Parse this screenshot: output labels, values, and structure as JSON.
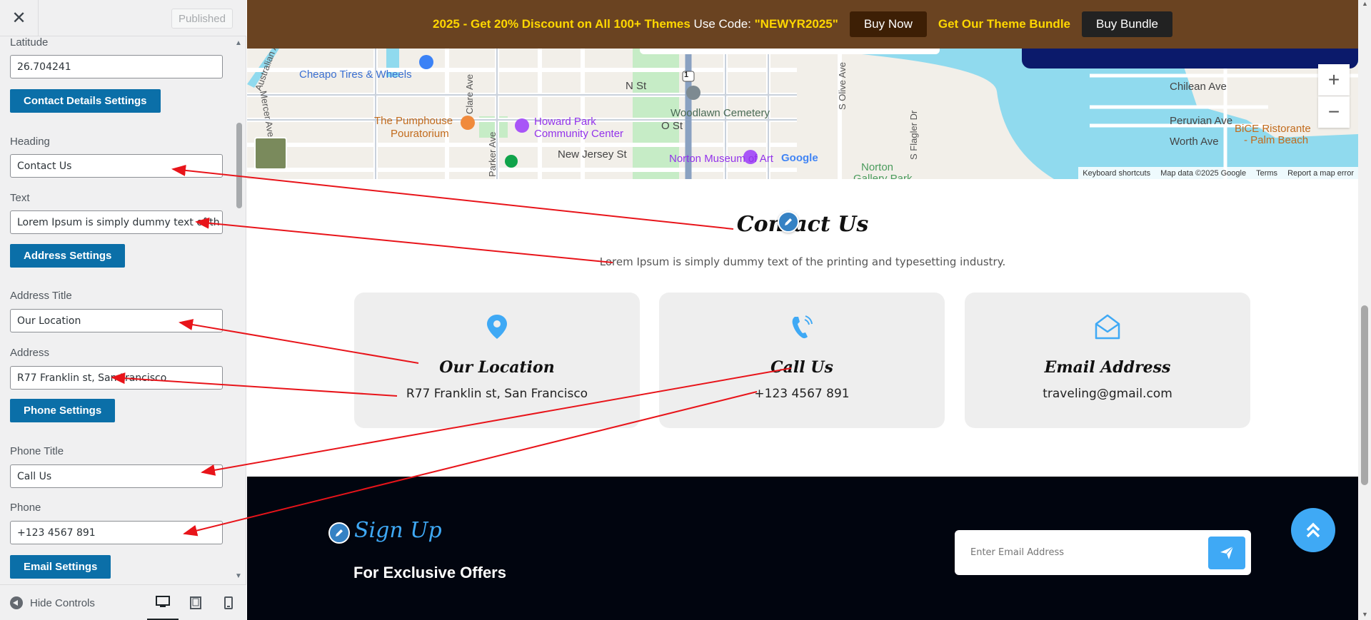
{
  "sidebar": {
    "close_label": "✕",
    "published_label": "Published",
    "latitude": {
      "label": "Latitude",
      "value": "26.704241"
    },
    "contact_details_btn": "Contact Details Settings",
    "heading": {
      "label": "Heading",
      "value": "Contact Us"
    },
    "text": {
      "label": "Text",
      "value": "Lorem Ipsum is simply dummy text of th"
    },
    "address_settings_btn": "Address Settings",
    "address_title": {
      "label": "Address Title",
      "value": "Our Location"
    },
    "address": {
      "label": "Address",
      "value": "R77 Franklin st, San Francisco"
    },
    "phone_settings_btn": "Phone Settings",
    "phone_title": {
      "label": "Phone Title",
      "value": "Call Us"
    },
    "phone": {
      "label": "Phone",
      "value": "+123 4567 891"
    },
    "email_settings_btn": "Email Settings",
    "hide_controls": "Hide Controls"
  },
  "promo": {
    "text_highlight": "2025 - Get 20% Discount on All 100+ Themes",
    "text_plain": "Use Code:",
    "code": "\"NEWYR2025\"",
    "buy_now": "Buy Now",
    "bundle_text": "Get Our Theme Bundle",
    "buy_bundle": "Buy Bundle"
  },
  "map": {
    "labels": {
      "cheapo": "Cheapo Tires & Wheels",
      "pumphouse_1": "The Pumphouse",
      "pumphouse_2": "Pouratorium",
      "howard_1": "Howard Park",
      "howard_2": "Community Center",
      "woodlawn": "Woodlawn Cemetery",
      "norton_museum": "Norton Museum of Art",
      "new_jersey": "New Jersey St",
      "n_st": "N St",
      "o_st": "O St",
      "chilean": "Chilean Ave",
      "peruvian": "Peruvian Ave",
      "worth": "Worth Ave",
      "bice_1": "BiCE Ristorante",
      "bice_2": "- Palm Beach",
      "clare": "Clare Ave",
      "parker": "Parker Ave",
      "mercer": "Mercer Ave",
      "australian": "Australian Av",
      "olive": "S Olive Ave",
      "flagler": "S Flagler Dr",
      "norton_gallery_1": "Norton",
      "norton_gallery_2": "Gallery Park",
      "route": "1",
      "google": "Google"
    },
    "attribution": [
      "Keyboard shortcuts",
      "Map data ©2025 Google",
      "Terms",
      "Report a map error"
    ],
    "zoom_in": "+",
    "zoom_out": "−"
  },
  "contact": {
    "heading": "Contact Us",
    "text": "Lorem Ipsum is simply dummy text of the printing and typesetting industry.",
    "cards": [
      {
        "title": "Our Location",
        "value": "R77 Franklin st, San Francisco",
        "icon": "location-pin-icon"
      },
      {
        "title": "Call Us",
        "value": "+123 4567 891",
        "icon": "phone-ringing-icon"
      },
      {
        "title": "Email Address",
        "value": "traveling@gmail.com",
        "icon": "envelope-open-icon"
      }
    ]
  },
  "footer": {
    "signup_title": "Sign Up",
    "signup_sub": "For Exclusive Offers",
    "email_placeholder": "Enter Email Address"
  },
  "colors": {
    "accent": "#3fa9f5",
    "section_button": "#0b6fa8",
    "promo_bg": "#6a4321",
    "footer_bg": "#01050f",
    "annotation_arrow": "#e8141a"
  }
}
